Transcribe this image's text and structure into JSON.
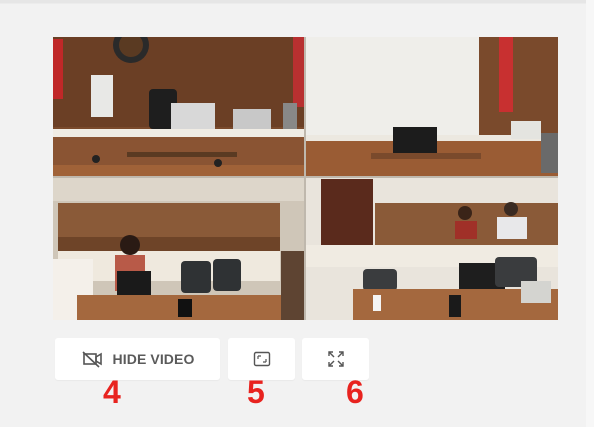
{
  "controls": {
    "hide_video_label": "HIDE VIDEO",
    "hide_video_icon": "video-off-icon",
    "fit_icon": "fit-screen-icon",
    "fullscreen_icon": "expand-icon"
  },
  "annotations": {
    "hide_video_number": "4",
    "fit_number": "5",
    "fullscreen_number": "6",
    "color": "#e8231f"
  },
  "video": {
    "content": "courtroom-multiview-feed"
  }
}
